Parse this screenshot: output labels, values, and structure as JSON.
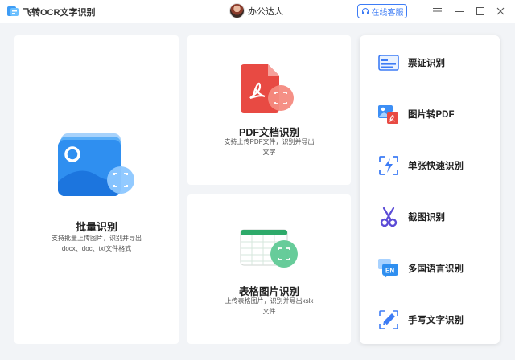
{
  "titlebar": {
    "app_title": "飞转OCR文字识别",
    "username": "办公达人",
    "service_label": "在线客服"
  },
  "cards": {
    "batch": {
      "title": "批量识别",
      "desc_line1": "支持批量上传图片，识别并导出",
      "desc_line2": "docx、doc、txt文件格式"
    },
    "pdf": {
      "title": "PDF文档识别",
      "desc_line1": "支持上传PDF文件，识别并导出",
      "desc_line2": "文字"
    },
    "table": {
      "title": "表格图片识别",
      "desc_line1": "上传表格图片，识别并导出xslx",
      "desc_line2": "文件"
    }
  },
  "side_menu": {
    "items": [
      {
        "label": "票证识别",
        "icon": "ticket-id-icon"
      },
      {
        "label": "图片转PDF",
        "icon": "image-to-pdf-icon"
      },
      {
        "label": "单张快速识别",
        "icon": "lightning-scan-icon"
      },
      {
        "label": "截图识别",
        "icon": "scissors-icon"
      },
      {
        "label": "多国语言识别",
        "icon": "language-en-icon"
      },
      {
        "label": "手写文字识别",
        "icon": "handwriting-pen-icon"
      }
    ]
  },
  "colors": {
    "accent": "#3d7cf5",
    "pdf_red": "#e84a43",
    "table_green": "#2eaa6a",
    "background": "#f2f4f7"
  }
}
